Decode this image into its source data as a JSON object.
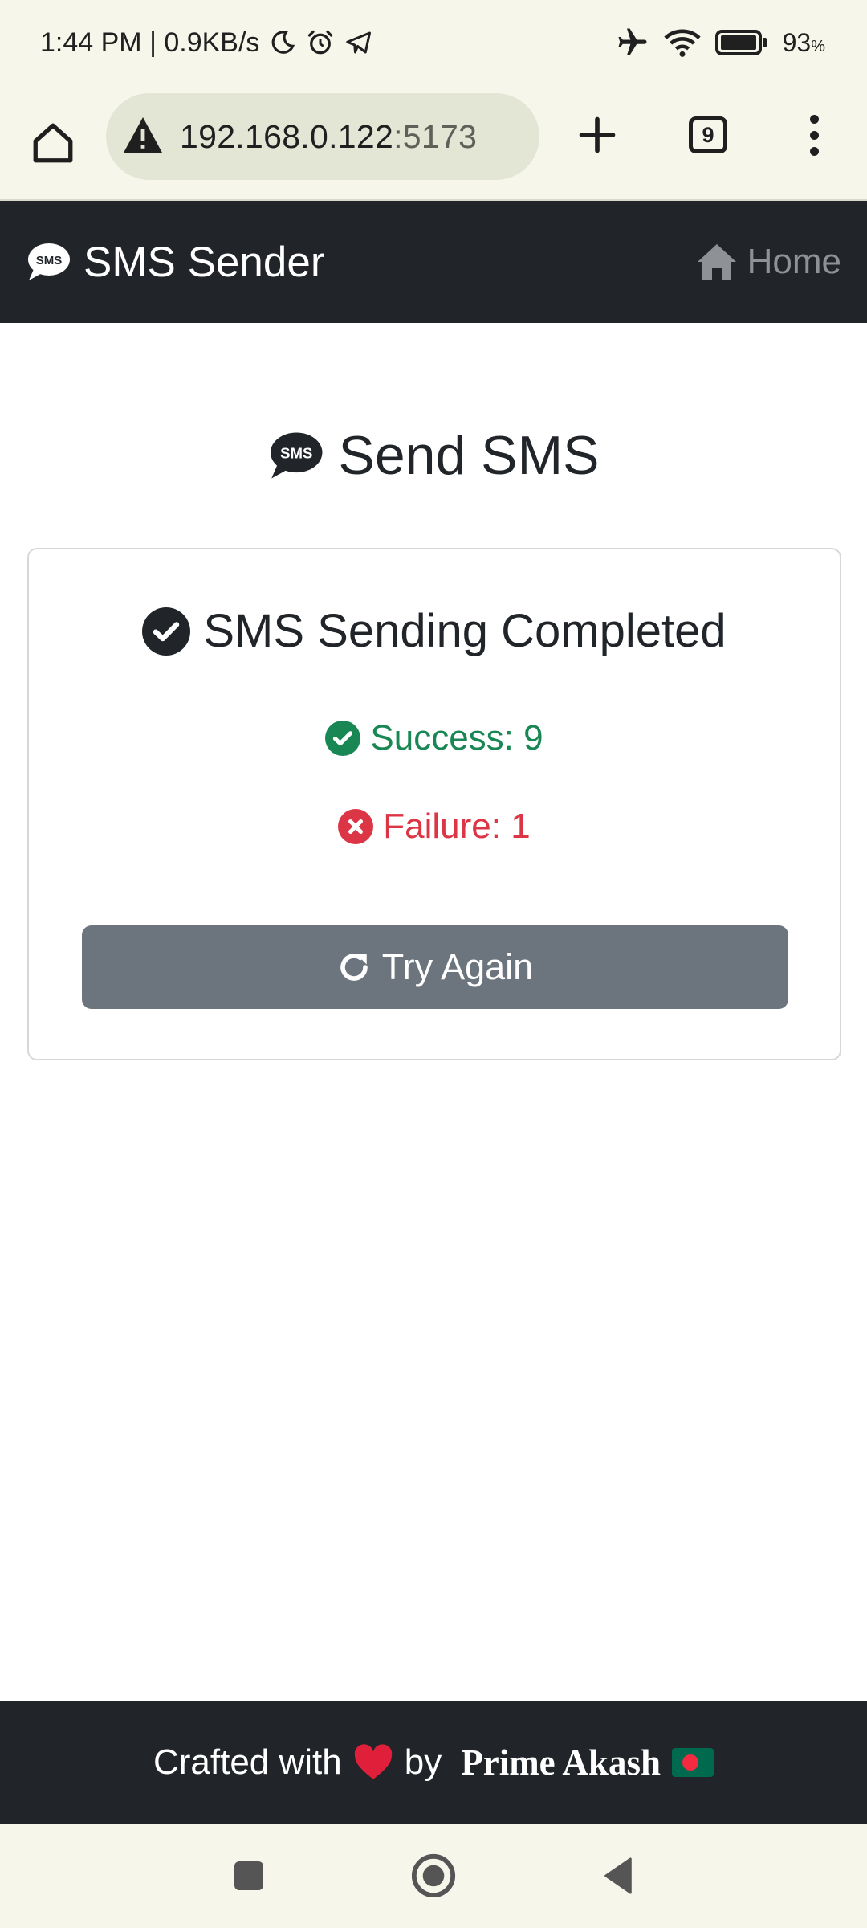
{
  "status_bar": {
    "time_speed": "1:44 PM | 0.9KB/s",
    "battery": "93",
    "battery_unit": "%"
  },
  "browser": {
    "url_host": "192.168.0.122",
    "url_port": ":5173",
    "tab_count": "9"
  },
  "navbar": {
    "brand": "SMS Sender",
    "home_label": "Home",
    "icon_label": "SMS"
  },
  "main": {
    "title": "Send SMS",
    "card_title": "SMS Sending Completed",
    "success_text": "Success: 9",
    "failure_text": "Failure: 1",
    "try_again_label": "Try Again"
  },
  "footer": {
    "prefix": "Crafted with",
    "by": "by",
    "author": "Prime Akash"
  },
  "colors": {
    "navbar_bg": "#212529",
    "success": "#198754",
    "failure": "#dc3545",
    "button_bg": "#6c757d",
    "chrome_bg": "#f6f7ea"
  },
  "icons": {
    "status": [
      "moon-icon",
      "alarm-icon",
      "telegram-icon",
      "airplane-icon",
      "wifi-icon",
      "battery-icon"
    ],
    "browser": [
      "home-icon",
      "warning-icon",
      "plus-icon",
      "tabs-icon",
      "more-vert-icon"
    ],
    "app": [
      "sms-bubble-icon",
      "house-icon",
      "check-circle-icon",
      "x-circle-icon",
      "redo-icon",
      "heart-icon",
      "bangladesh-flag-icon"
    ],
    "nav": [
      "recents-square-icon",
      "home-circle-icon",
      "back-triangle-icon"
    ]
  }
}
